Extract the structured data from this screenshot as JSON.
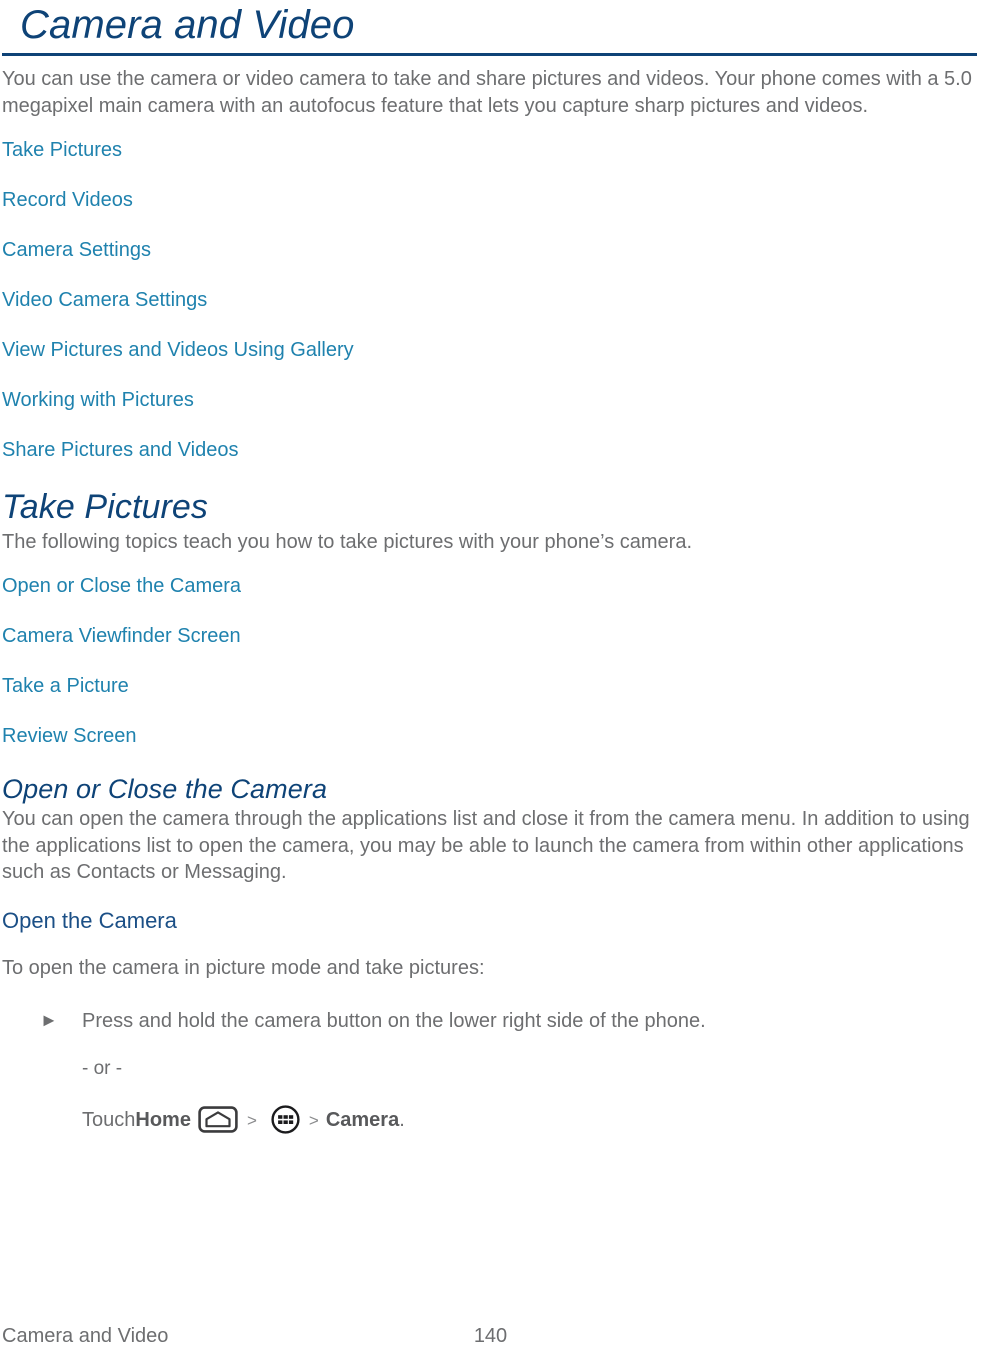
{
  "document": {
    "title": "Camera and Video",
    "intro_paragraph": "You can use the camera or video camera to take and share pictures and videos. Your phone comes with a 5.0 megapixel main camera with an autofocus feature that lets you capture sharp pictures and videos."
  },
  "topic_links": [
    {
      "label": "Take Pictures"
    },
    {
      "label": "Record Videos"
    },
    {
      "label": "Camera Settings"
    },
    {
      "label": "Video Camera Settings"
    },
    {
      "label": "View Pictures and Videos Using Gallery"
    },
    {
      "label": "Working with Pictures"
    },
    {
      "label": "Share Pictures and Videos"
    }
  ],
  "take_pictures": {
    "heading": "Take Pictures",
    "intro": "The following topics teach you how to take pictures with your phone’s camera.",
    "links": [
      {
        "label": "Open or Close the Camera"
      },
      {
        "label": "Camera Viewfinder Screen"
      },
      {
        "label": "Take a Picture"
      },
      {
        "label": "Review Screen"
      }
    ]
  },
  "open_or_close": {
    "heading": "Open or Close the Camera",
    "paragraph": "You can open the camera through the applications list and close it from the camera menu. In addition to using the applications list to open the camera, you may be able to launch the camera from within other applications such as Contacts or Messaging.",
    "subheading": "Open the Camera",
    "lead_in": "To open the camera in picture mode and take pictures:",
    "step": {
      "marker": "►",
      "text": "Press and hold the camera button on the lower right side of the phone."
    },
    "or_text": "- or -",
    "touch_line": {
      "prefix": "Touch ",
      "home_label": "Home",
      "home_icon": "home-key-icon",
      "separator_1": ">",
      "apps_icon": "apps-grid-icon",
      "separator_2": ">",
      "target_label": "Camera",
      "suffix": "."
    }
  },
  "footer": {
    "chapter": "Camera and Video",
    "page_number": "140"
  },
  "colors": {
    "heading_navy": "#0e4377",
    "link_blue": "#1f82ae",
    "body_gray": "#6d6e70",
    "rule_navy": "#0e4377"
  }
}
